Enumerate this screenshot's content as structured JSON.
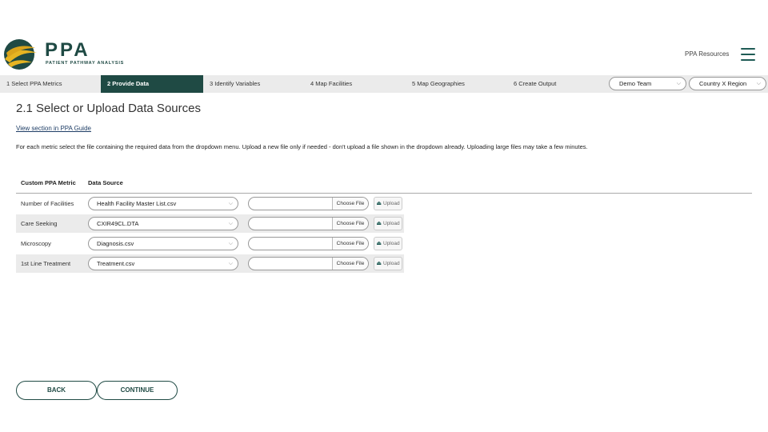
{
  "brand": {
    "title": "PPA",
    "subtitle": "PATIENT PATHWAY ANALYSIS",
    "colors": {
      "primary": "#1f4a44",
      "accent": "#e6b422"
    }
  },
  "header": {
    "resources_label": "PPA Resources",
    "menu_icon": "hamburger-icon"
  },
  "steps": [
    {
      "label": "1 Select PPA Metrics",
      "active": false
    },
    {
      "label": "2 Provide Data",
      "active": true
    },
    {
      "label": "3 Identify Variables",
      "active": false
    },
    {
      "label": "4 Map Facilities",
      "active": false
    },
    {
      "label": "5 Map Geographies",
      "active": false
    },
    {
      "label": "6 Create Output",
      "active": false
    }
  ],
  "selectors": {
    "team": "Demo Team",
    "region": "Country X Region"
  },
  "main": {
    "title": "2.1 Select or Upload Data Sources",
    "guide_link": "View section in PPA Guide",
    "instructions": "For each metric select the file containing the required data from the dropdown menu. Upload a new file only if needed - don't upload a file shown in the dropdown already. Uploading large files may take a few minutes.",
    "table": {
      "headers": [
        "Custom PPA Metric",
        "Data Source"
      ],
      "rows": [
        {
          "metric": "Number of Facilities",
          "source": "Health Facility Master List.csv",
          "choose": "Choose File",
          "upload": "Upload"
        },
        {
          "metric": "Care Seeking",
          "source": "CXIR49CL.DTA",
          "choose": "Choose File",
          "upload": "Upload"
        },
        {
          "metric": "Microscopy",
          "source": "Diagnosis.csv",
          "choose": "Choose File",
          "upload": "Upload"
        },
        {
          "metric": "1st Line Treatment",
          "source": "Treatment.csv",
          "choose": "Choose File",
          "upload": "Upload"
        }
      ]
    }
  },
  "footer": {
    "back_label": "BACK",
    "continue_label": "CONTINUE"
  }
}
